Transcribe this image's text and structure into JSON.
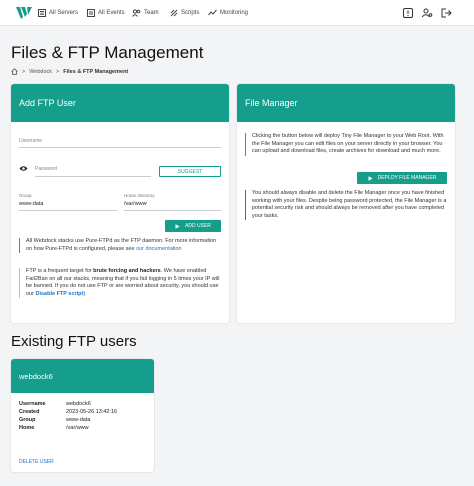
{
  "nav": {
    "all_servers": "All Servers",
    "all_events": "All Events",
    "team": "Team",
    "scripts": "Scripts",
    "monitoring": "Monitoring"
  },
  "page": {
    "title": "Files & FTP Management",
    "breadcrumb": {
      "parent": "Webdock",
      "separator": ">",
      "current": "Files & FTP Management"
    }
  },
  "add_ftp": {
    "header": "Add FTP User",
    "username_placeholder": "Username",
    "password_placeholder": "Password",
    "suggest_label": "SUGGEST",
    "group_label": "Group",
    "group_value": "www-data",
    "home_label": "Home directory",
    "home_value": "/var/www",
    "add_user_label": "ADD USER",
    "note1_text": "All Webdock stacks use Pure-FTPd as the FTP daemon. For more information on how Pure-FTPd is configured, please see ",
    "note1_link": "our documentation",
    "note2_text_a": "FTP is a frequent target for ",
    "note2_bold": "brute forcing and hackers",
    "note2_text_b": ". We have enabled Fail2Ban on all our stacks, meaning that if you fail logging in 5 times your IP will be banned. If you do not use FTP or are worried about security, you should use our ",
    "note2_link": "Disable FTP script",
    "note2_text_c": ")"
  },
  "file_manager": {
    "header": "File Manager",
    "intro": "Clicking the button below will deploy Tiny File Manager to your Web Root. With the File Manager you can edit files on your server directly in your browser. You can upload and download files, create archives for download and much more.",
    "deploy_label": "DEPLOY FILE MANAGER",
    "warning": "You should always disable and delete the File Manager once you have finished working with your files. Despite being password protected, the File Manager is a potential security risk and should always be removed after you have completed your tasks."
  },
  "existing": {
    "title": "Existing FTP users",
    "users": [
      {
        "name": "webdock6",
        "fields": [
          {
            "key": "Username",
            "value": "webdock6"
          },
          {
            "key": "Created",
            "value": "2023-05-26 13:42:16"
          },
          {
            "key": "Group",
            "value": "www-data"
          },
          {
            "key": "Home",
            "value": "/var/www"
          }
        ],
        "delete_label": "DELETE USER"
      }
    ]
  },
  "colors": {
    "accent": "#169e8d",
    "info_border": "#1aa58f",
    "warn_border": "#f2c718",
    "danger_border": "#d9342b",
    "link": "#1a73c8"
  },
  "icons": [
    "logo-icon",
    "servers-icon",
    "events-icon",
    "team-icon",
    "scripts-icon",
    "monitoring-icon",
    "alert-icon",
    "user-settings-icon",
    "logout-icon",
    "home-icon",
    "eye-icon",
    "play-icon"
  ]
}
